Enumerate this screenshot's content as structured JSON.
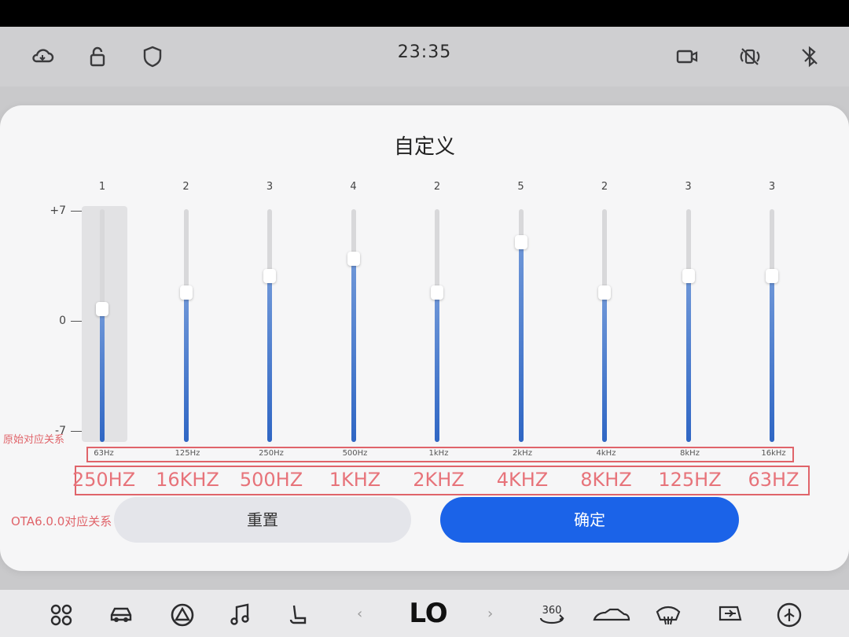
{
  "status_bar": {
    "time": "23:35",
    "left_icons": [
      "cloud-icon",
      "lock-icon",
      "shield-icon"
    ],
    "right_icons": [
      "camera-icon",
      "wireless-icon",
      "bluetooth-off-icon"
    ]
  },
  "dialog": {
    "title": "自定义",
    "scale": {
      "top": "+7",
      "mid": "0",
      "bottom": "-7"
    },
    "bands": [
      {
        "value": "1",
        "level": 1,
        "freq": "63Hz",
        "ota": "250HZ"
      },
      {
        "value": "2",
        "level": 2,
        "freq": "125Hz",
        "ota": "16KHZ"
      },
      {
        "value": "3",
        "level": 3,
        "freq": "250Hz",
        "ota": "500HZ"
      },
      {
        "value": "4",
        "level": 4,
        "freq": "500Hz",
        "ota": "1KHZ"
      },
      {
        "value": "2",
        "level": 2,
        "freq": "1kHz",
        "ota": "2KHZ"
      },
      {
        "value": "5",
        "level": 5,
        "freq": "2kHz",
        "ota": "4KHZ"
      },
      {
        "value": "2",
        "level": 2,
        "freq": "4kHz",
        "ota": "8KHZ"
      },
      {
        "value": "3",
        "level": 3,
        "freq": "8kHz",
        "ota": "125HZ"
      },
      {
        "value": "3",
        "level": 3,
        "freq": "16kHz",
        "ota": "63HZ"
      }
    ],
    "annotation_original": "原始对应关系",
    "annotation_ota": "OTA6.0.0对应关系",
    "reset_label": "重置",
    "confirm_label": "确定",
    "accent_color": "#1b63e8"
  },
  "dock": {
    "temperature": "LO",
    "left_icons": [
      "apps-icon",
      "car-icon",
      "steering-icon",
      "music-icon",
      "seat-icon"
    ],
    "right_icons": [
      "camera-360-icon",
      "car-side-icon",
      "defrost-front-icon",
      "defrost-rear-icon",
      "fan-icon"
    ],
    "camera_360_label": "360"
  }
}
